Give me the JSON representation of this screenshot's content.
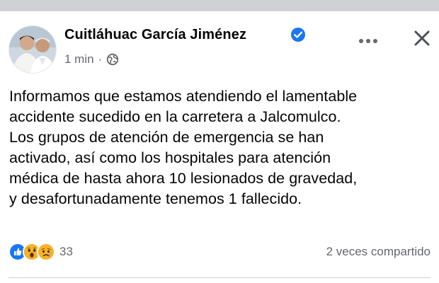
{
  "post": {
    "author_name": "Cuitláhuac García Jiménez",
    "verified": true,
    "timestamp": "1 min",
    "separator": "·",
    "privacy_icon": "globe-icon",
    "more_icon": "more-horizontal-icon",
    "close_icon": "close-icon",
    "text": "Informamos que estamos atendiendo el lamentable\naccidente sucedido en la carretera a Jalcomulco.\nLos grupos de atención de emergencia se han\nactivado, así como los hospitales para atención\nmédica de hasta ahora 10 lesionados de gravedad,\ny desafortunadamente tenemos 1 fallecido.",
    "reactions": {
      "icons": [
        "like-reaction-icon",
        "wow-reaction-icon",
        "sad-reaction-icon"
      ],
      "count": "33"
    },
    "shares_text": "2 veces compartido"
  },
  "colors": {
    "verified_blue": "#1877f2",
    "secondary_text": "#65676b",
    "primary_text": "#050505",
    "reaction_yellow": "#f7b125"
  }
}
